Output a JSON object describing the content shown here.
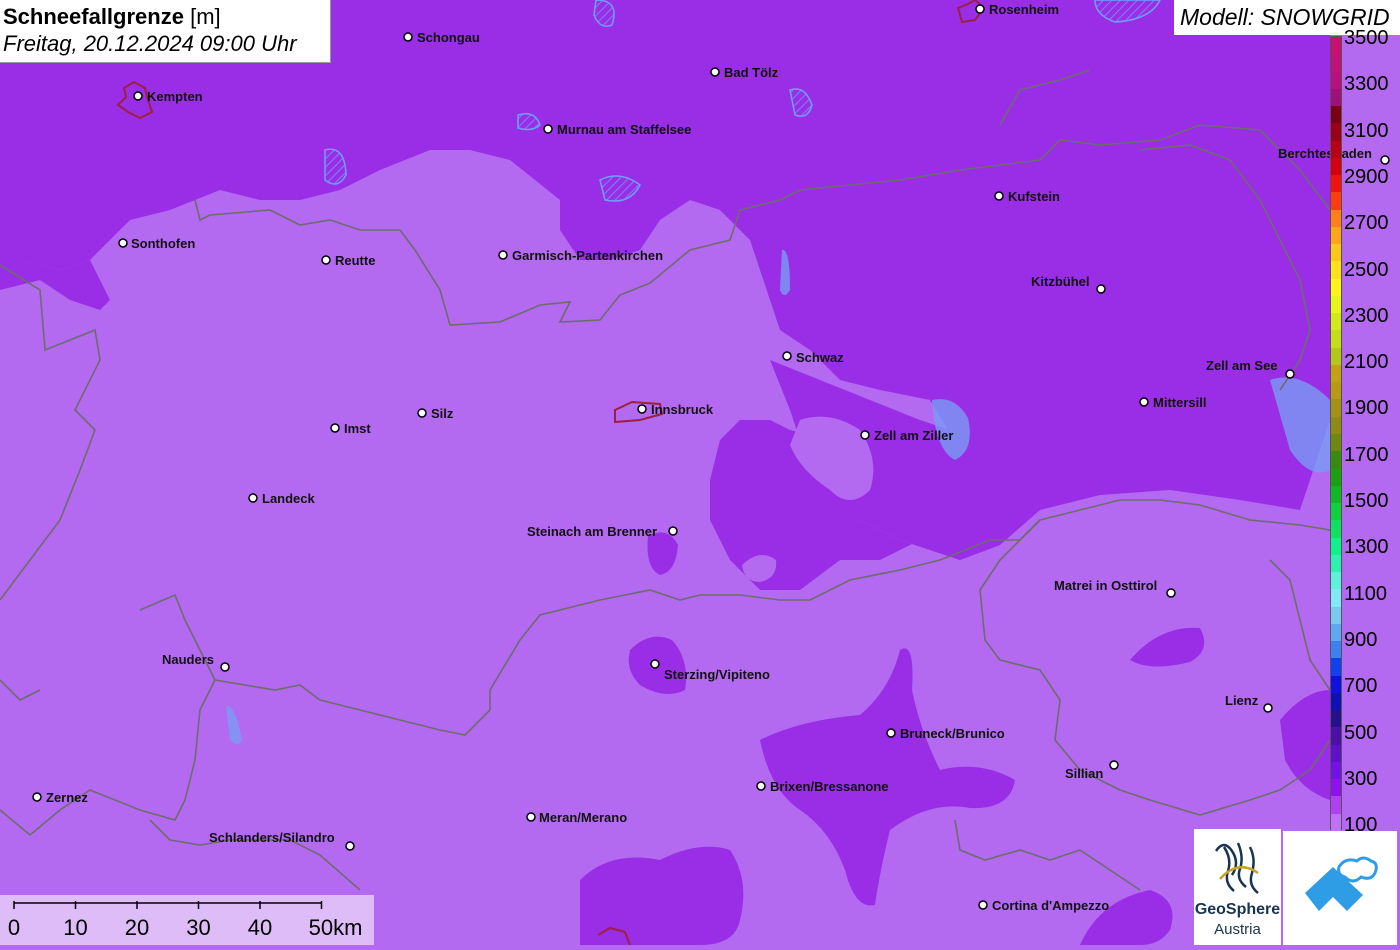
{
  "header": {
    "title_bold": "Schneefallgrenze",
    "title_unit": "[m]",
    "subtitle": "Freitag, 20.12.2024 09:00 Uhr"
  },
  "model": {
    "label": "Modell: SNOWGRID"
  },
  "legend": {
    "labels": [
      "3500",
      "3300",
      "3100",
      "2900",
      "2700",
      "2500",
      "2300",
      "2100",
      "1900",
      "1700",
      "1500",
      "1300",
      "1100",
      "900",
      "700",
      "500",
      "300",
      "100"
    ],
    "colors": [
      "#c8106e",
      "#c2107a",
      "#b8117f",
      "#a0107a",
      "#7c0016",
      "#9a0018",
      "#b80018",
      "#d40012",
      "#f21010",
      "#ff3b10",
      "#ff7f1a",
      "#ffa51a",
      "#ffc61a",
      "#ffe21a",
      "#fff51a",
      "#e8f51a",
      "#d2ea1a",
      "#c4dc1a",
      "#b4c81a",
      "#c4a014",
      "#b89a14",
      "#a49214",
      "#8e8c14",
      "#6e8812",
      "#3a8a12",
      "#1aa010",
      "#10b828",
      "#10d040",
      "#10e064",
      "#10f08c",
      "#30f0b4",
      "#60f0dc",
      "#80e8f8",
      "#78c8f0",
      "#60a8f0",
      "#3c80f0",
      "#1040f0",
      "#1010e0",
      "#1010b4",
      "#28108c",
      "#4c10a8",
      "#6010c8",
      "#7410e8",
      "#9010f0",
      "#b040f0",
      "#c070f8"
    ]
  },
  "cities": [
    {
      "name": "Rosenheim"
    },
    {
      "name": "Schongau"
    },
    {
      "name": "Bad Tölz"
    },
    {
      "name": "Kempten"
    },
    {
      "name": "Murnau am Staffelsee"
    },
    {
      "name": "Berchtesgaden"
    },
    {
      "name": "Kufstein"
    },
    {
      "name": "Sonthofen"
    },
    {
      "name": "Reutte"
    },
    {
      "name": "Garmisch-Partenkirchen"
    },
    {
      "name": "Kitzbühel"
    },
    {
      "name": "Schwaz"
    },
    {
      "name": "Zell am See"
    },
    {
      "name": "Mittersill"
    },
    {
      "name": "Imst"
    },
    {
      "name": "Silz"
    },
    {
      "name": "Innsbruck"
    },
    {
      "name": "Zell am Ziller"
    },
    {
      "name": "Landeck"
    },
    {
      "name": "Steinach am Brenner"
    },
    {
      "name": "Matrei in Osttirol"
    },
    {
      "name": "Nauders"
    },
    {
      "name": "Sterzing/Vipiteno"
    },
    {
      "name": "Lienz"
    },
    {
      "name": "Bruneck/Brunico"
    },
    {
      "name": "Sillian"
    },
    {
      "name": "Brixen/Bressanone"
    },
    {
      "name": "Zernez"
    },
    {
      "name": "Meran/Merano"
    },
    {
      "name": "Schlanders/Silandro"
    },
    {
      "name": "Cortina d'Ampezzo"
    }
  ],
  "scale_bar": {
    "ticks": [
      "0",
      "10",
      "20",
      "30",
      "40",
      "50km"
    ]
  },
  "logos": {
    "geosphere_line1": "GeoSphere",
    "geosphere_line2": "Austria"
  },
  "colors": {
    "light_zone": "#b36af0",
    "dark_zone": "#9a2ee6",
    "border": "#6c6c6c"
  }
}
